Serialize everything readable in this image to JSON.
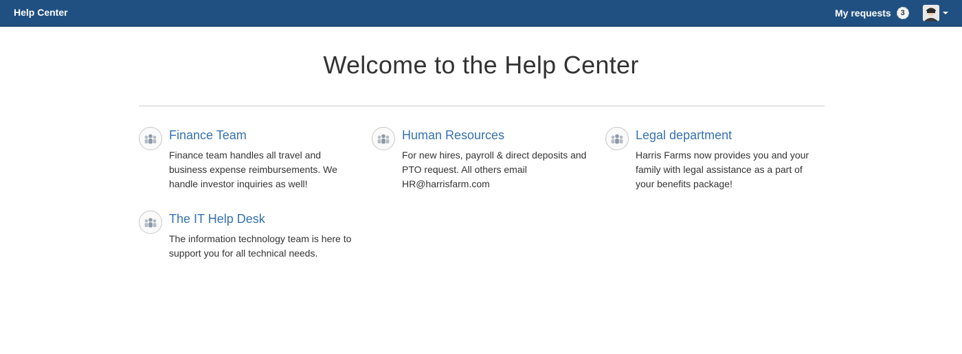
{
  "header": {
    "brand": "Help Center",
    "my_requests_label": "My requests",
    "my_requests_count": "3",
    "accent_color": "#205081"
  },
  "main": {
    "title": "Welcome to the Help Center",
    "portals": [
      {
        "title": "Finance Team",
        "description": "Finance team handles all travel and business expense reimbursements. We handle investor inquiries as well!",
        "icon": "people-group-icon"
      },
      {
        "title": "Human Resources",
        "description": "For new hires, payroll & direct deposits and PTO request. All others email HR@harrisfarm.com",
        "icon": "people-group-icon"
      },
      {
        "title": "Legal department",
        "description": "Harris Farms now provides you and your family with legal assistance as a part of your benefits package!",
        "icon": "people-group-icon"
      },
      {
        "title": "The IT Help Desk",
        "description": "The information technology team is here to support you for all technical needs.",
        "icon": "people-group-icon"
      }
    ]
  }
}
